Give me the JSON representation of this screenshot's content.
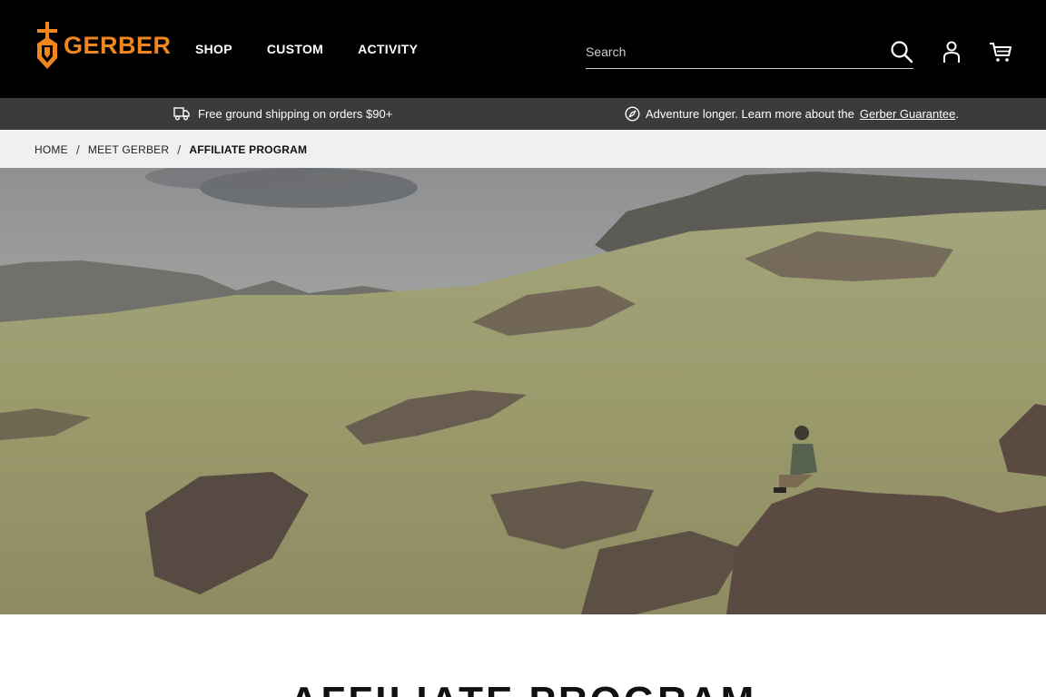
{
  "brand": {
    "name": "GERBER",
    "accent": "#f0861d"
  },
  "nav": {
    "items": [
      {
        "label": "SHOP"
      },
      {
        "label": "CUSTOM"
      },
      {
        "label": "ACTIVITY"
      }
    ]
  },
  "search": {
    "placeholder": "Search",
    "value": ""
  },
  "header_icons": [
    "search-icon",
    "account-icon",
    "cart-icon"
  ],
  "promo": {
    "shipping": "Free ground shipping on orders $90+",
    "guarantee_text": "Adventure longer. Learn more about the",
    "guarantee_link": "Gerber Guarantee",
    "guarantee_end": "."
  },
  "breadcrumb": {
    "items": [
      "HOME",
      "MEET GERBER",
      "AFFILIATE PROGRAM"
    ],
    "separator": "/"
  },
  "page": {
    "heading": "AFFILIATE PROGRAM"
  },
  "colors": {
    "header_bg": "#000000",
    "promo_bg": "#3a3b3b",
    "breadcrumb_bg": "#f0f0f0"
  }
}
